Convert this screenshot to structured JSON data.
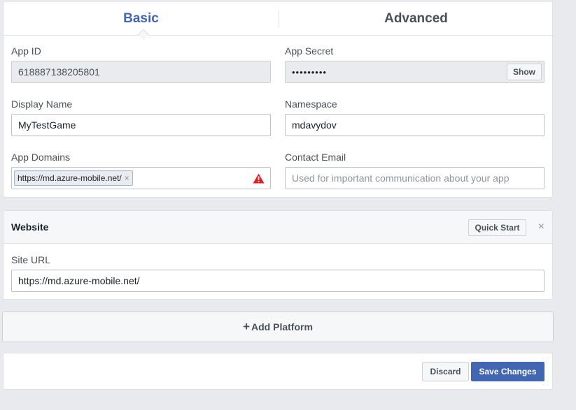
{
  "tabs": {
    "basic": "Basic",
    "advanced": "Advanced"
  },
  "fields": {
    "app_id": {
      "label": "App ID",
      "value": "618887138205801"
    },
    "app_secret": {
      "label": "App Secret",
      "value": "•••••••••",
      "show_button": "Show"
    },
    "display_name": {
      "label": "Display Name",
      "value": "MyTestGame"
    },
    "namespace": {
      "label": "Namespace",
      "value": "mdavydov"
    },
    "app_domains": {
      "label": "App Domains",
      "token": "https://md.azure-mobile.net/",
      "token_remove": "×"
    },
    "contact_email": {
      "label": "Contact Email",
      "placeholder": "Used for important communication about your app"
    }
  },
  "website": {
    "title": "Website",
    "quick_start": "Quick Start",
    "close": "×",
    "site_url_label": "Site URL",
    "site_url_value": "https://md.azure-mobile.net/"
  },
  "add_platform": {
    "plus": "+",
    "label": "Add Platform"
  },
  "footer": {
    "discard": "Discard",
    "save": "Save Changes"
  },
  "colors": {
    "accent": "#4267b2",
    "warning": "#e02020",
    "background": "#e9eaed"
  },
  "icons": {
    "warning": "warning-icon",
    "close": "close-icon",
    "plus": "plus-icon"
  }
}
